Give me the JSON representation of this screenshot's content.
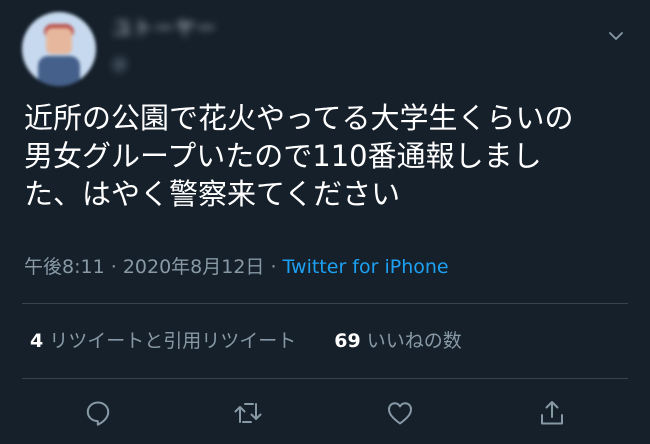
{
  "tweet": {
    "author": {
      "display_name": "ユトーヤー",
      "username": "@"
    },
    "text": "近所の公園で花火やってる大学生くらいの\n男女グループいたので110番通報しまし\nた、はやく警察来てください",
    "time": "午後8:11",
    "date": "2020年8月12日",
    "separator": "·",
    "source": "Twitter for iPhone"
  },
  "stats": {
    "retweets_count": "4",
    "retweets_label": "リツイートと引用リツイート",
    "likes_count": "69",
    "likes_label": "いいねの数"
  },
  "icons": {
    "caret": "chevron-down-icon",
    "reply": "reply-icon",
    "retweet": "retweet-icon",
    "like": "heart-icon",
    "share": "share-icon"
  },
  "colors": {
    "background": "#15202b",
    "text": "#ffffff",
    "secondary": "#8899a6",
    "link": "#1da1f2",
    "divider": "#38444d"
  }
}
